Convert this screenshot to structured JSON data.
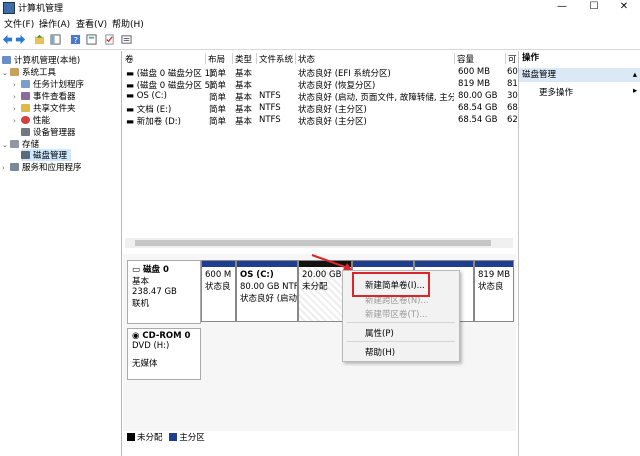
{
  "window": {
    "title": "计算机管理",
    "controls": {
      "min": "—",
      "max": "☐",
      "close": "✕"
    }
  },
  "menu": [
    "文件(F)",
    "操作(A)",
    "查看(V)",
    "帮助(H)"
  ],
  "tree": {
    "root": "计算机管理(本地)",
    "system_tools": "系统工具",
    "task_scheduler": "任务计划程序",
    "event_viewer": "事件查看器",
    "shared_folders": "共享文件夹",
    "performance": "性能",
    "device_manager": "设备管理器",
    "storage": "存储",
    "disk_management": "磁盘管理",
    "services": "服务和应用程序"
  },
  "volumes": {
    "headers": [
      "卷",
      "布局",
      "类型",
      "文件系统",
      "状态",
      "容量",
      "可"
    ],
    "rows": [
      [
        "(磁盘 0 磁盘分区 1)",
        "简单",
        "基本",
        "",
        "状态良好 (EFI 系统分区)",
        "600 MB",
        "60"
      ],
      [
        "(磁盘 0 磁盘分区 5)",
        "简单",
        "基本",
        "",
        "状态良好 (恢复分区)",
        "819 MB",
        "81"
      ],
      [
        "OS (C:)",
        "简单",
        "基本",
        "NTFS",
        "状态良好 (启动, 页面文件, 故障转储, 主分区)",
        "80.00 GB",
        "30"
      ],
      [
        "文档 (E:)",
        "简单",
        "基本",
        "NTFS",
        "状态良好 (主分区)",
        "68.54 GB",
        "68"
      ],
      [
        "新加卷 (D:)",
        "简单",
        "基本",
        "NTFS",
        "状态良好 (主分区)",
        "68.54 GB",
        "62"
      ]
    ]
  },
  "disk0": {
    "name": "磁盘 0",
    "type": "基本",
    "size": "238.47 GB",
    "status": "联机",
    "partitions": [
      {
        "l1": "600 M",
        "l2": "状态良",
        "kind": "primary"
      },
      {
        "l1": "OS  (C:)",
        "l2": "80.00 GB NTF",
        "l3": "状态良好 (启动",
        "kind": "primary"
      },
      {
        "l1": "20.00 GB",
        "l2": "未分配",
        "kind": "unallocated"
      },
      {
        "l1": "TF",
        "l2": "",
        "kind": "primary"
      },
      {
        "l1": "819 MB",
        "l2": "状态良",
        "kind": "primary"
      }
    ]
  },
  "cdrom": {
    "name": "CD-ROM 0",
    "type": "DVD (H:)",
    "status": "无媒体"
  },
  "legend": {
    "unallocated": "未分配",
    "primary": "主分区",
    "colors": {
      "unallocated": "#000000",
      "primary": "#1f3e8f"
    }
  },
  "actions": {
    "title": "操作",
    "header": "磁盘管理",
    "more": "更多操作"
  },
  "context_menu": {
    "items": [
      "新建简单卷(I)...",
      "新建跨区卷(N)...",
      "新建带区卷(T)...",
      "属性(P)",
      "帮助(H)"
    ],
    "disabled": [
      false,
      true,
      true,
      false,
      false
    ]
  }
}
